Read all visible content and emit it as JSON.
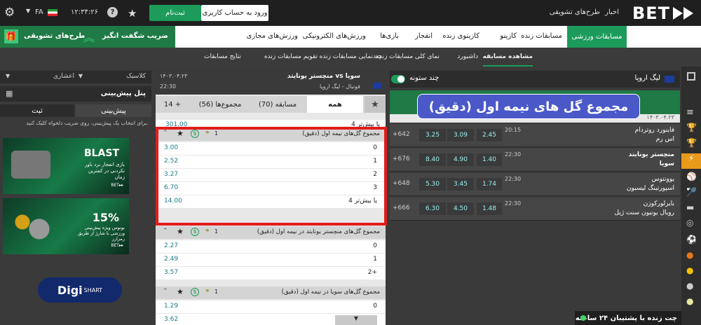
{
  "header": {
    "logo": "BET",
    "nav_news": "اخبار",
    "nav_promos": "طرح‌های تشویقی",
    "login": "ورود به حساب کاربری",
    "register": "ثبت‌نام",
    "time": "۱۲:۳۴:۲۶",
    "lang": "FA"
  },
  "main_nav": [
    "مسابقات ورزشی",
    "مسابقات زنده",
    "کازینو",
    "کازینوی زنده",
    "انفجار",
    "بازی‌ها",
    "ورزش‌های الکترونیکی",
    "ورزش‌های مجازی"
  ],
  "promo": {
    "left1": "ضریب شگفت انگیز",
    "left2": "طرح‌های تشویقی"
  },
  "sub_nav": [
    "مشاهده مسابقه",
    "داشبورد",
    "نمای کلی مسابقات زنده",
    "چندنمایی مسابقات زنده",
    "تقویم مسابقات زنده",
    "نتایج مسابقات"
  ],
  "overlay_title": "مجموع گل های نیمه اول (دقیق)",
  "left": {
    "league": "لیگ اروپا",
    "multi": "چند ستونه",
    "date": "۱۴۰۳.۰۴.۲۳",
    "matches": [
      {
        "team1": "فاینورد روتردام",
        "team2": "اس رم",
        "time": "20:15",
        "o1": "2.45",
        "o2": "3.09",
        "o3": "3.25",
        "more": "+642"
      },
      {
        "team1": "منچستر یونایتد",
        "team2": "سویا",
        "time": "22:30",
        "o1": "1.40",
        "o2": "4.90",
        "o3": "8.40",
        "more": "+676"
      },
      {
        "team1": "یوونتوس",
        "team2": "اسپورتینگ لیسبون",
        "time": "22:30",
        "o1": "1.74",
        "o2": "3.45",
        "o3": "5.30",
        "more": "+648"
      },
      {
        "team1": "بایرلورکوزن",
        "team2": "رویال یونیون سنت ژیل",
        "time": "22:30",
        "o1": "1.48",
        "o2": "4.50",
        "o3": "6.30",
        "more": "+666"
      }
    ]
  },
  "middle": {
    "match_title": "منچستر یونایتد vs سویا",
    "sub": "فوتبال - لیگ اروپا",
    "date": "۱۴۰۳.۰۴.۲۳",
    "time": "22:30",
    "tabs": [
      "همه",
      "مسابقه (70)",
      "مجموع‌ها (56)",
      "14 +"
    ],
    "top_row": {
      "label": "4 یا بیش‌تر",
      "odd": "301.00"
    },
    "market1": {
      "title": "مجموع گل‌های نیمه اول (دقیق)",
      "count": "1",
      "rows": [
        {
          "label": "0",
          "odd": "3.00"
        },
        {
          "label": "1",
          "odd": "2.52"
        },
        {
          "label": "2",
          "odd": "3.27"
        },
        {
          "label": "3",
          "odd": "6.70"
        },
        {
          "label": "4 یا بیش‌تر",
          "odd": "14.00"
        }
      ]
    },
    "market2": {
      "title": "مجموع گل‌های منچستر یونایتد در نیمه اول (دقیق)",
      "count": "1",
      "rows": [
        {
          "label": "0",
          "odd": "2.27"
        },
        {
          "label": "1",
          "odd": "2.49"
        },
        {
          "label": "2+",
          "odd": "3.57"
        }
      ]
    },
    "market3": {
      "title": "مجموع گل‌های سویا در نیمه اول (دقیق)",
      "count": "1",
      "rows": [
        {
          "label": "0",
          "odd": "1.29"
        },
        {
          "label": "1",
          "odd": "3.62"
        }
      ]
    }
  },
  "right": {
    "classic": "کلاسیک",
    "decimal": "اعشاری",
    "panel": "پنل پیش‌بینی",
    "tab_bet": "پیش‌بینی",
    "tab_reg": "ثبت",
    "hint": "برای انتخاب یک پیش‌بینی، روی ضریب دلخواه کلیک کنید.",
    "banner1": {
      "title": "BLAST",
      "text": "بازی انفجار برد باور نکردنی در کمترین زمان",
      "brand": "BET▸▸"
    },
    "banner2": {
      "title": "15%",
      "text": "بونوس ویژه پیش‌بینی ورزشی با شارژ از طریق رمزارز",
      "brand": "BET▸▸"
    },
    "watermark": "Digi",
    "watermark2": "SHART"
  },
  "chat": "چت زنده با پشتیبان ۲۴ ساعته",
  "colors": {
    "accent": "#1c9b5b",
    "highlight": "#e21c1c",
    "overlay": "#4a58c8"
  }
}
